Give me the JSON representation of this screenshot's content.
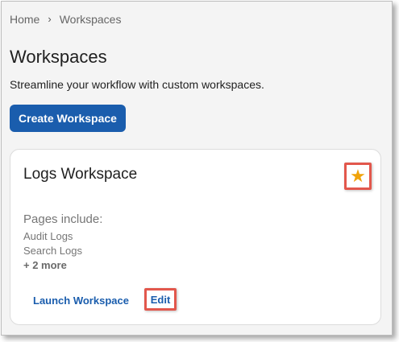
{
  "breadcrumb": {
    "home": "Home",
    "separator": "›",
    "current": "Workspaces"
  },
  "page": {
    "title": "Workspaces",
    "subtitle": "Streamline your workflow with custom workspaces."
  },
  "actions": {
    "create_label": "Create Workspace"
  },
  "workspace_card": {
    "title": "Logs Workspace",
    "favorite_icon": "star-icon",
    "favorite_glyph": "★",
    "favorite_color": "#f0a30a",
    "pages_label": "Pages include:",
    "pages": [
      "Audit Logs",
      "Search Logs"
    ],
    "more_label": "+ 2 more",
    "launch_label": "Launch Workspace",
    "edit_label": "Edit"
  },
  "colors": {
    "primary": "#1a5dad",
    "highlight": "#e2574c",
    "background": "#f4f4f4"
  }
}
